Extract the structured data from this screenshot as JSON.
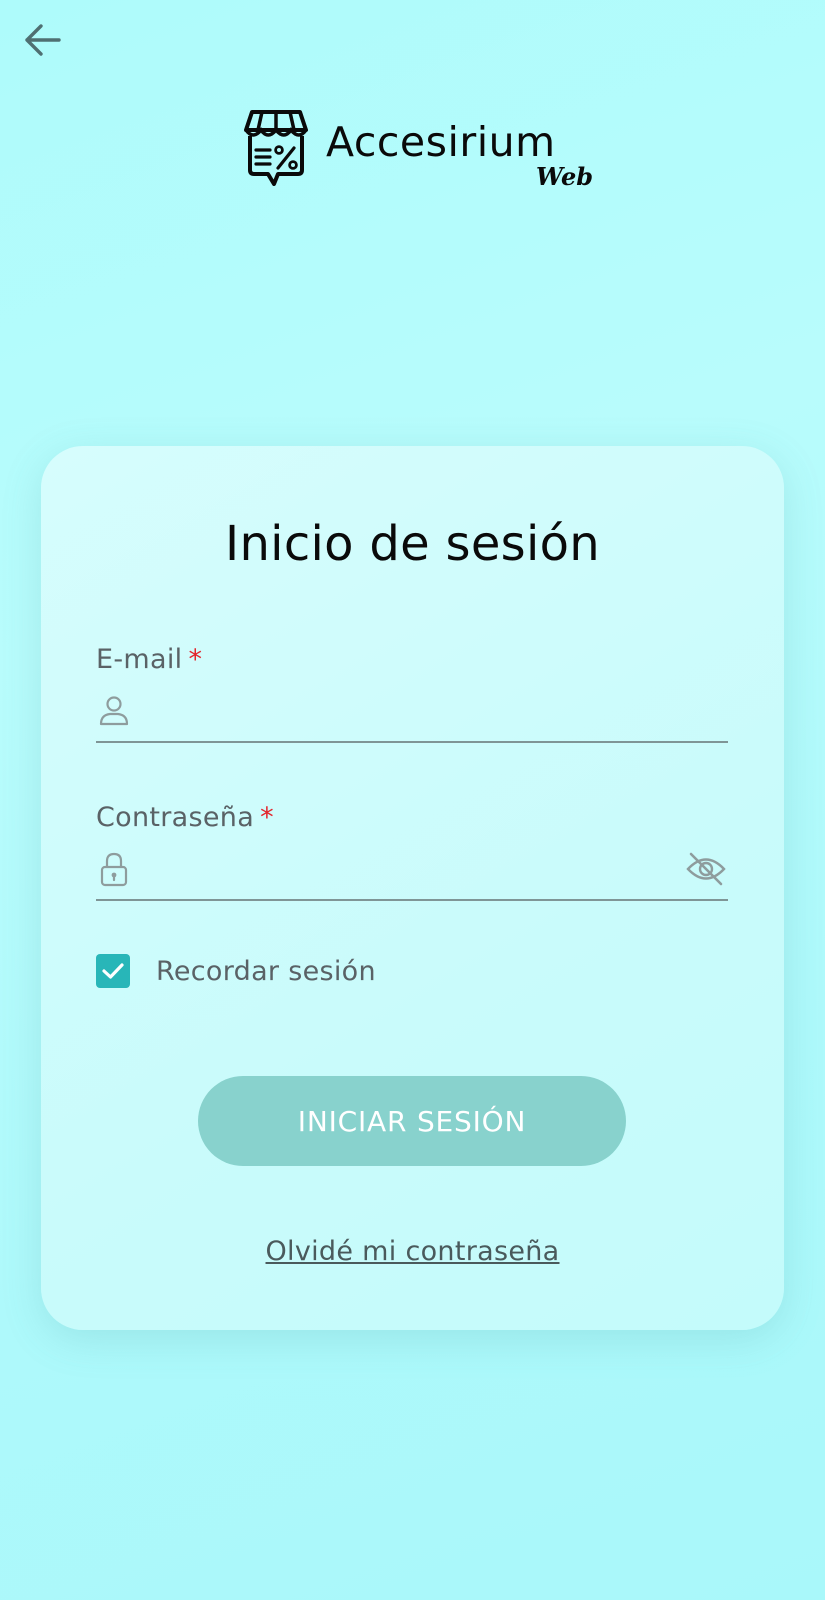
{
  "nav": {
    "back_icon": "arrow-left-icon"
  },
  "brand": {
    "name": "Accesirium",
    "sub": "Web",
    "logo_icon": "storefront-percent-icon"
  },
  "login": {
    "title": "Inicio de sesión",
    "email": {
      "label": "E-mail",
      "required_mark": "*",
      "value": "",
      "icon": "user-icon"
    },
    "password": {
      "label": "Contraseña",
      "required_mark": "*",
      "value": "",
      "icon": "lock-icon",
      "toggle_icon": "eye-off-icon"
    },
    "remember": {
      "label": "Recordar sesión",
      "checked": true
    },
    "submit_label": "INICIAR SESIÓN",
    "forgot_label": "Olvidé mi contraseña"
  },
  "colors": {
    "background": "#aefbfb",
    "card": "#cdfcfc",
    "accent": "#28b6b8",
    "button": "#88d2cd",
    "required": "#e3242b",
    "label": "#5a6266"
  }
}
